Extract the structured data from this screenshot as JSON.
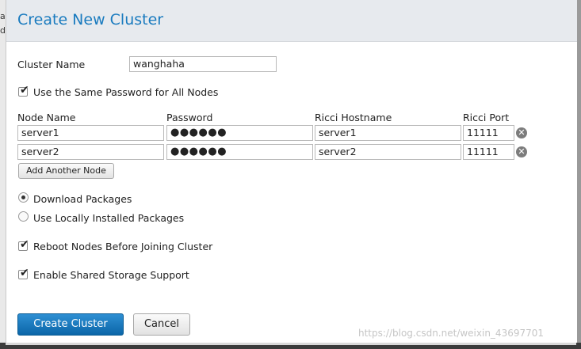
{
  "backdrop": {
    "left_fragment_top": "a",
    "left_fragment_mid": "d"
  },
  "dialog": {
    "title": "Create New Cluster",
    "cluster_name_label": "Cluster Name",
    "cluster_name_value": "wanghaha",
    "same_password_label": "Use the Same Password for All Nodes",
    "same_password_checked": true,
    "columns": {
      "node_name": "Node Name",
      "password": "Password",
      "ricci_hostname": "Ricci Hostname",
      "ricci_port": "Ricci Port"
    },
    "nodes": [
      {
        "name": "server1",
        "password": "●●●●●●",
        "hostname": "server1",
        "port": "11111"
      },
      {
        "name": "server2",
        "password": "●●●●●●",
        "hostname": "server2",
        "port": "11111"
      }
    ],
    "add_node_label": "Add Another Node",
    "package_options": [
      {
        "label": "Download Packages",
        "selected": true
      },
      {
        "label": "Use Locally Installed Packages",
        "selected": false
      }
    ],
    "reboot_label": "Reboot Nodes Before Joining Cluster",
    "reboot_checked": true,
    "shared_storage_label": "Enable Shared Storage Support",
    "shared_storage_checked": true,
    "create_label": "Create Cluster",
    "cancel_label": "Cancel"
  },
  "watermark": "https://blog.csdn.net/weixin_43697701",
  "colors": {
    "title": "#1a7bbf",
    "primary_button": "#0b66a8",
    "header_bg": "#e7eaee"
  },
  "icons": {
    "checkbox": "checkmark-icon",
    "remove": "close-circle-icon"
  }
}
